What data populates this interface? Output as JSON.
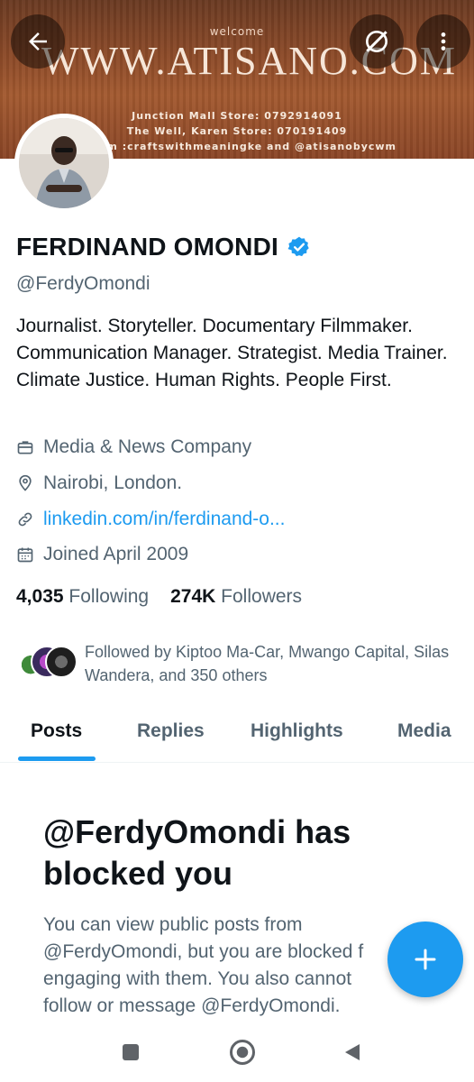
{
  "banner": {
    "welcome": "welcome",
    "site": "WWW.ATISANO.COM",
    "line1": "Junction Mall Store: 0792914091",
    "line2": "The Well, Karen Store: 070191409",
    "line3": "am :craftswithmeaningke and @atisanobycwm"
  },
  "topbar": {
    "back_icon": "arrow-left-icon",
    "grok_icon": "grok-icon",
    "more_icon": "more-vertical-icon"
  },
  "profile": {
    "name": "FERDINAND OMONDI",
    "verified_icon": "verified-badge-icon",
    "handle": "@FerdyOmondi",
    "bio": "Journalist. Storyteller. Documentary Filmmaker. Communication Manager.  Strategist.  Media Trainer.  Climate Justice. Human Rights. People First.",
    "category": "Media & News Company",
    "location": "Nairobi, London.",
    "link": "linkedin.com/in/ferdinand-o...",
    "joined": "Joined April 2009",
    "following_count": "4,035",
    "following_label": "Following",
    "followers_count": "274K",
    "followers_label": "Followers",
    "followed_by": "Followed by Kiptoo Ma-Car, Mwango Capital, Silas Wandera, and 350 others"
  },
  "tabs": [
    {
      "label": "Posts",
      "active": true
    },
    {
      "label": "Replies",
      "active": false
    },
    {
      "label": "Highlights",
      "active": false
    },
    {
      "label": "Media",
      "active": false
    }
  ],
  "blocked": {
    "title": "@FerdyOmondi has blocked you",
    "body": "You can view public posts from @FerdyOmondi, but you are blocked f engaging with them. You also cannot follow or message @FerdyOmondi."
  },
  "colors": {
    "accent": "#1d9bf0",
    "text_primary": "#0f1419",
    "text_secondary": "#536471"
  }
}
